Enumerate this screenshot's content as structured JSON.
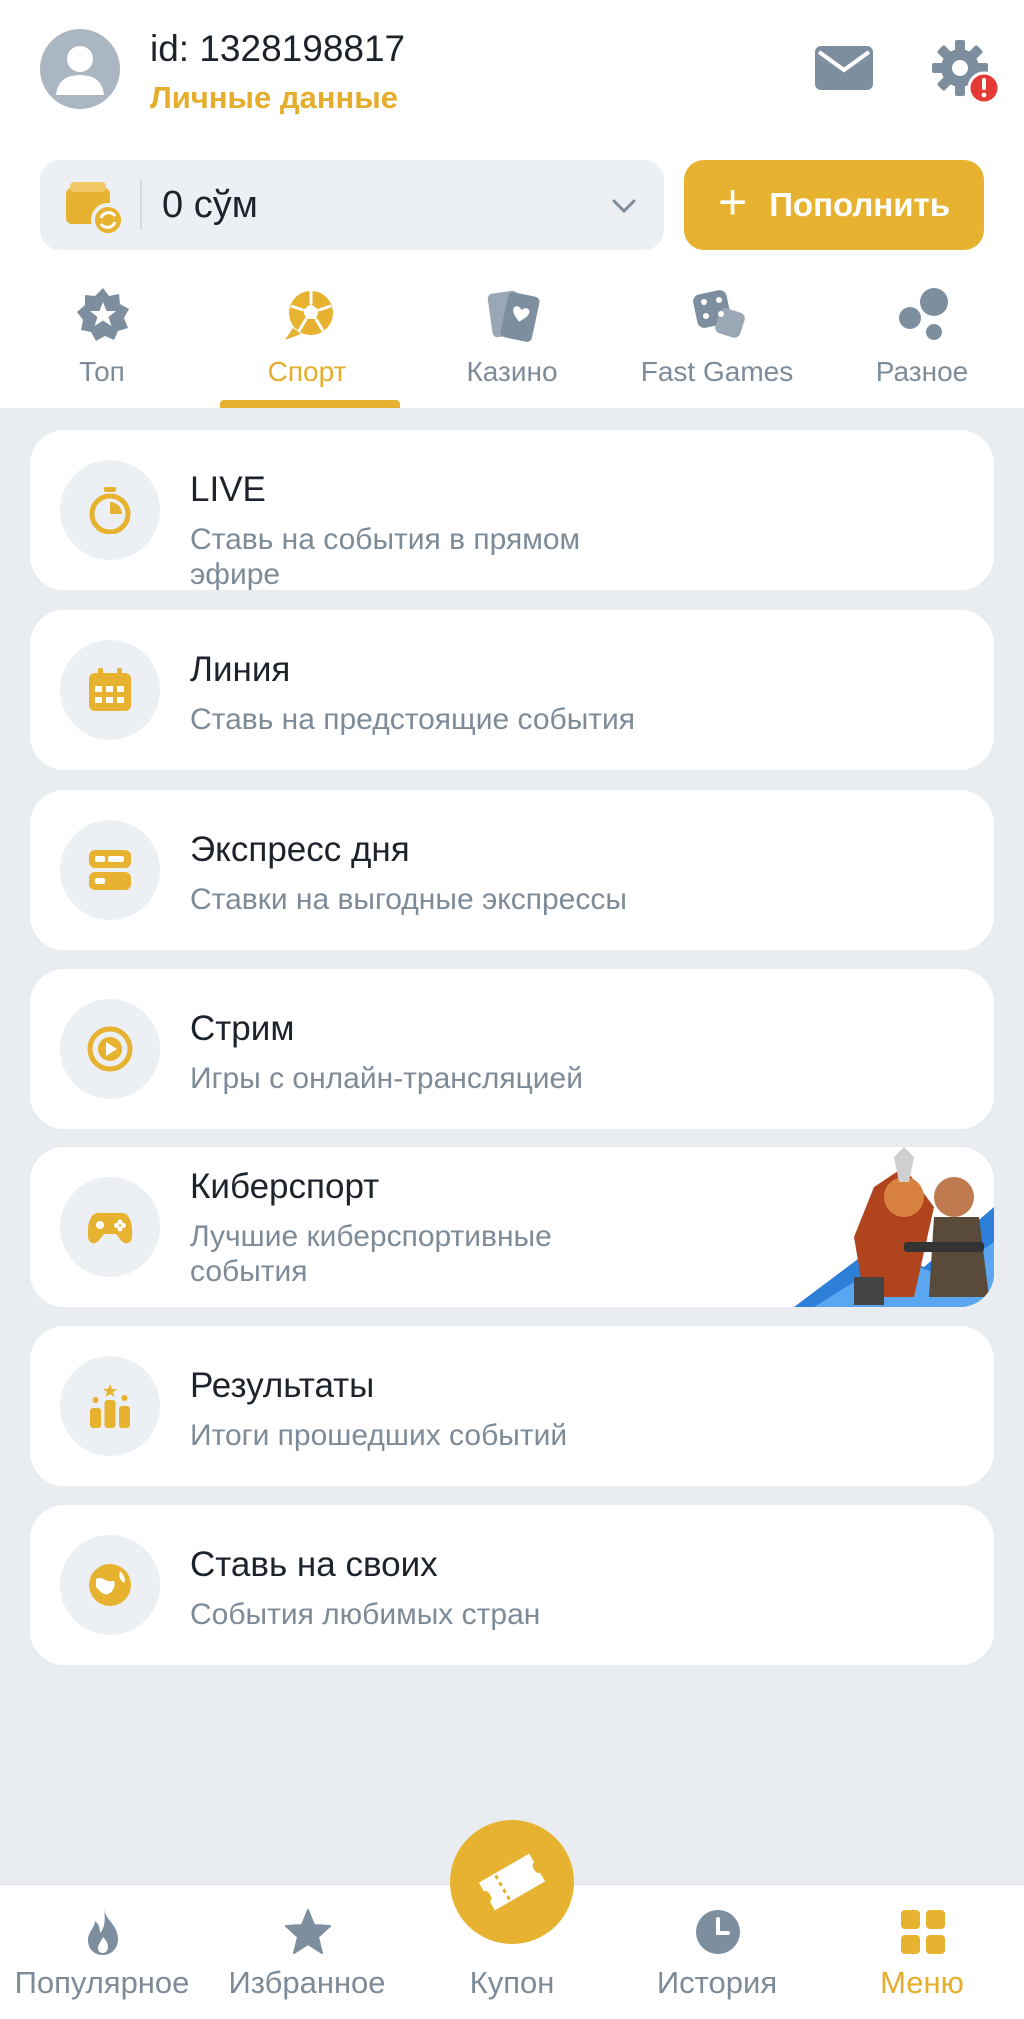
{
  "header": {
    "user_id": "id: 1328198817",
    "personal_link": "Личные данные",
    "icons": [
      "avatar-icon",
      "mail-icon",
      "gear-icon",
      "alert-badge-icon"
    ],
    "colors": {
      "accent": "#e6b22f",
      "alert": "#e53935",
      "muted": "#7d8b99"
    }
  },
  "balance": {
    "amount": "0 сўм",
    "deposit_label": "Пополнить",
    "deposit_plus": "+"
  },
  "categories": [
    {
      "label": "Топ",
      "icon": "star-badge-icon",
      "active": false
    },
    {
      "label": "Спорт",
      "icon": "soccer-ball-icon",
      "active": true
    },
    {
      "label": "Казино",
      "icon": "cards-icon",
      "active": false
    },
    {
      "label": "Fast Games",
      "icon": "dice-icon",
      "active": false
    },
    {
      "label": "Разное",
      "icon": "bubbles-icon",
      "active": false
    }
  ],
  "menu": [
    {
      "title": "LIVE",
      "subtitle": "Ставь на события в прямом эфире",
      "icon": "stopwatch-icon"
    },
    {
      "title": "Линия",
      "subtitle": "Ставь на предстоящие события",
      "icon": "calendar-icon"
    },
    {
      "title": "Экспресс дня",
      "subtitle": "Ставки на выгодные экспрессы",
      "icon": "ticket-list-icon"
    },
    {
      "title": "Стрим",
      "subtitle": "Игры с онлайн-трансляцией",
      "icon": "play-circle-icon"
    },
    {
      "title": "Киберспорт",
      "subtitle": "Лучшие киберспортивные события",
      "icon": "gamepad-icon"
    },
    {
      "title": "Результаты",
      "subtitle": "Итоги прошедших событий",
      "icon": "podium-icon"
    },
    {
      "title": "Ставь на своих",
      "subtitle": "События любимых стран",
      "icon": "globe-icon"
    }
  ],
  "bottom_nav": [
    {
      "label": "Популярное",
      "icon": "fire-icon",
      "active": false
    },
    {
      "label": "Избранное",
      "icon": "star-icon",
      "active": false
    },
    {
      "label": "Купон",
      "icon": "coupon-icon",
      "active": false
    },
    {
      "label": "История",
      "icon": "clock-icon",
      "active": false
    },
    {
      "label": "Меню",
      "icon": "grid-icon",
      "active": true
    }
  ]
}
